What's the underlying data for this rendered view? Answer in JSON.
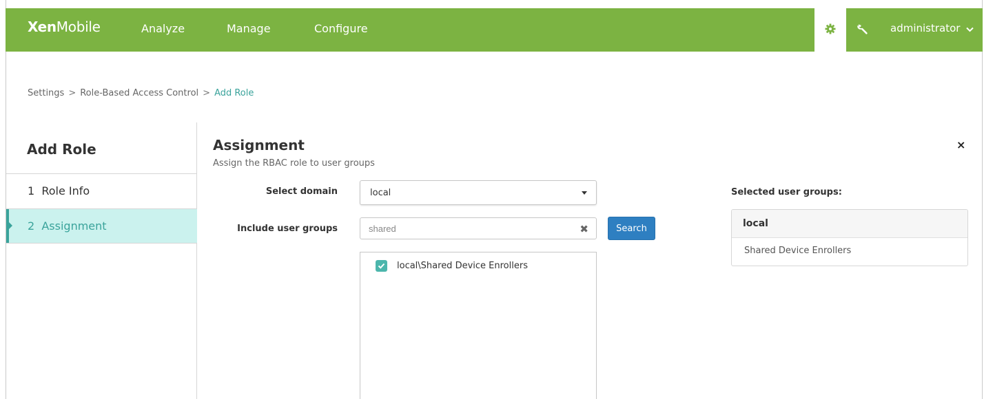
{
  "app": {
    "logo_bold": "Xen",
    "logo_light": "Mobile"
  },
  "nav": {
    "analyze": "Analyze",
    "manage": "Manage",
    "configure": "Configure",
    "settings_icon": "gear-icon",
    "tools_icon": "wrench-icon",
    "user": "administrator"
  },
  "breadcrumb": {
    "items": [
      "Settings",
      "Role-Based Access Control",
      "Add Role"
    ],
    "separator": ">"
  },
  "sidebar": {
    "title": "Add Role",
    "steps": [
      {
        "label": "1  Role Info",
        "active": false
      },
      {
        "label": "2  Assignment",
        "active": true
      }
    ]
  },
  "main": {
    "title": "Assignment",
    "subtitle": "Assign the RBAC role to user groups",
    "close_label": "×",
    "domain": {
      "label": "Select domain",
      "value": "local"
    },
    "groups": {
      "label": "Include user groups",
      "value": "shared",
      "search_label": "Search"
    },
    "results": [
      {
        "label": "local\\Shared Device Enrollers",
        "checked": true
      }
    ],
    "selected": {
      "title": "Selected user groups:",
      "domain": "local",
      "items": [
        "Shared Device Enrollers"
      ]
    }
  },
  "colors": {
    "header": "#7cb342",
    "accent": "#3aa39b",
    "active_step_bg": "#cbf2ee",
    "button": "#2e7fc1",
    "checkbox": "#4cb6ac"
  }
}
